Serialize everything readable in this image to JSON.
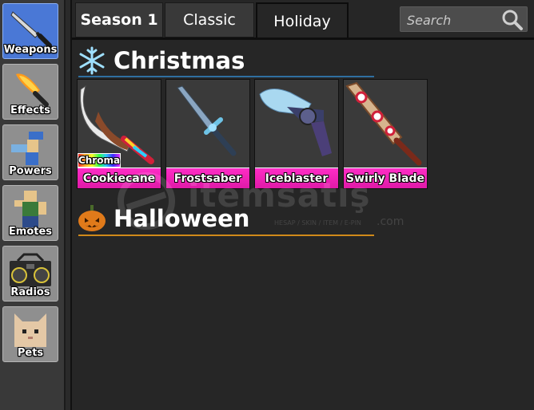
{
  "sidebar": {
    "items": [
      {
        "label": "Weapons",
        "icon": "knife-icon",
        "active": true
      },
      {
        "label": "Effects",
        "icon": "flaming-knife-icon",
        "active": false
      },
      {
        "label": "Powers",
        "icon": "running-avatar-icon",
        "active": false
      },
      {
        "label": "Emotes",
        "icon": "dancing-avatar-icon",
        "active": false
      },
      {
        "label": "Radios",
        "icon": "boombox-icon",
        "active": false
      },
      {
        "label": "Pets",
        "icon": "cat-icon",
        "active": false
      }
    ]
  },
  "tabs": [
    {
      "label": "Season 1",
      "active": false
    },
    {
      "label": "Classic",
      "active": false
    },
    {
      "label": "Holiday",
      "active": true
    }
  ],
  "search": {
    "placeholder": "Search",
    "value": ""
  },
  "sections": [
    {
      "title": "Christmas",
      "icon": "snowflake-icon",
      "underline_color": "#2f6fa0",
      "items": [
        {
          "name": "Cookiecane",
          "badge": "Chroma",
          "icon": "candy-cane-knife-icon"
        },
        {
          "name": "Frostsaber",
          "badge": "",
          "icon": "ice-sword-icon"
        },
        {
          "name": "Iceblaster",
          "badge": "",
          "icon": "ice-gun-icon"
        },
        {
          "name": "Swirly Blade",
          "badge": "",
          "icon": "peppermint-blade-icon"
        }
      ]
    },
    {
      "title": "Halloween",
      "icon": "pumpkin-icon",
      "underline_color": "#d08a1a",
      "items": []
    }
  ],
  "watermark": {
    "text": "itemsatış",
    "tagline": "HESAP / SKIN / ITEM / E-PIN",
    "suffix": ".com"
  },
  "colors": {
    "accent_active": "#4a78d6",
    "item_label": "#ff2dc6",
    "sidebar_button": "#8f8f8f"
  }
}
